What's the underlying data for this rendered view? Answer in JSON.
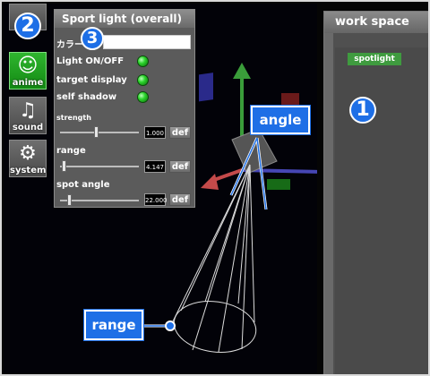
{
  "sidebar": {
    "items": [
      {
        "label": ""
      },
      {
        "label": "anime"
      },
      {
        "label": "sound"
      },
      {
        "label": "system"
      }
    ]
  },
  "panel": {
    "title": "Sport light (overall)",
    "color_label": "カラー",
    "light_onoff_label": "Light ON/OFF",
    "target_display_label": "target display",
    "self_shadow_label": "self shadow",
    "strength_label": "strength",
    "strength_value": "1.000",
    "range_label": "range",
    "range_value": "4.147",
    "spot_angle_label": "spot angle",
    "spot_angle_value": "22.000",
    "def_label": "def"
  },
  "workspace": {
    "title": "work space",
    "item_label": "spotlight"
  },
  "annotations": {
    "angle_label": "angle",
    "range_label": "range",
    "badge_1": "1",
    "badge_2": "2",
    "badge_3": "3"
  },
  "colors": {
    "accent_blue": "#1e6fe6",
    "led_green": "#2bd42b",
    "axis_green": "#3a9d3a",
    "axis_red": "#c44a4a",
    "axis_blue": "#4646b4"
  }
}
